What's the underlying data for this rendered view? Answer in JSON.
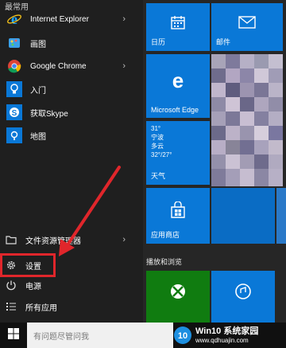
{
  "start_menu": {
    "section_header": "最常用",
    "apps": [
      {
        "label": "Internet Explorer",
        "icon": "ie-icon",
        "has_arrow": true
      },
      {
        "label": "画图",
        "icon": "paint-icon",
        "has_arrow": false
      },
      {
        "label": "Google Chrome",
        "icon": "chrome-icon",
        "has_arrow": true
      },
      {
        "label": "入门",
        "icon": "tips-icon",
        "has_arrow": false
      },
      {
        "label": "获取Skype",
        "icon": "skype-icon",
        "has_arrow": false
      },
      {
        "label": "地图",
        "icon": "maps-icon",
        "has_arrow": false
      }
    ],
    "bottom": {
      "file_explorer": "文件资源管理器",
      "settings": "设置",
      "power": "电源",
      "all_apps": "所有应用"
    }
  },
  "tiles": {
    "calendar": "日历",
    "mail": "邮件",
    "edge": "Microsoft Edge",
    "weather": {
      "temp": "31°",
      "city": "宁波",
      "condition": "多云",
      "range": "32°/27°",
      "label": "天气"
    },
    "store": "应用商店",
    "section_play": "播放和浏览"
  },
  "taskbar": {
    "search_placeholder": "有问题尽管问我"
  },
  "watermark": {
    "title": "Win10 系统家园",
    "url": "www.qdhuajin.com",
    "logo_text": "10"
  },
  "colors": {
    "tile_blue": "#0a78d7",
    "highlight_red": "#e0262b",
    "xbox_green": "#107c10"
  }
}
